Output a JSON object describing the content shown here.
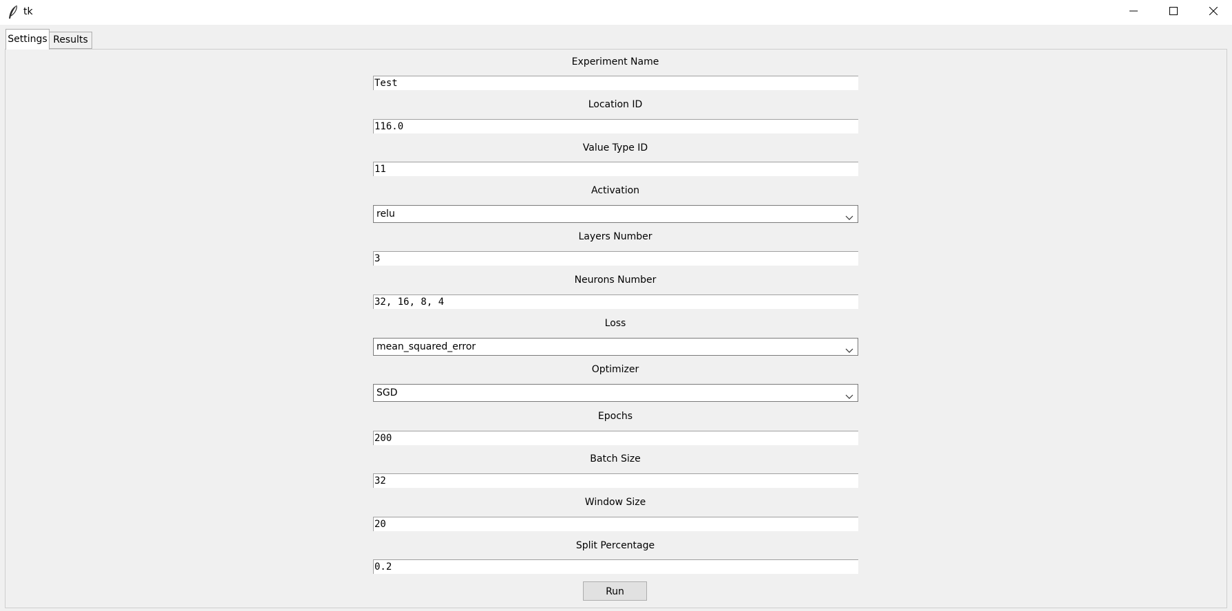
{
  "window": {
    "title": "tk"
  },
  "tabs": [
    {
      "label": "Settings",
      "selected": true
    },
    {
      "label": "Results",
      "selected": false
    }
  ],
  "form": {
    "experiment_name": {
      "label": "Experiment Name",
      "value": "Test"
    },
    "location_id": {
      "label": "Location ID",
      "value": "116.0"
    },
    "value_type_id": {
      "label": "Value Type ID",
      "value": "11"
    },
    "activation": {
      "label": "Activation",
      "value": "relu"
    },
    "layers_number": {
      "label": "Layers Number",
      "value": "3"
    },
    "neurons_number": {
      "label": "Neurons Number",
      "value": "32, 16, 8, 4"
    },
    "loss": {
      "label": "Loss",
      "value": "mean_squared_error"
    },
    "optimizer": {
      "label": "Optimizer",
      "value": "SGD"
    },
    "epochs": {
      "label": "Epochs",
      "value": "200"
    },
    "batch_size": {
      "label": "Batch Size",
      "value": "32"
    },
    "window_size": {
      "label": "Window Size",
      "value": "20"
    },
    "split_percentage": {
      "label": "Split Percentage",
      "value": "0.2"
    }
  },
  "run_button": {
    "label": "Run"
  },
  "icons": {
    "app": "feather-icon",
    "minimize": "minimize-icon",
    "maximize": "maximize-icon",
    "close": "close-icon",
    "dropdown": "chevron-down-icon"
  },
  "colors": {
    "background": "#f0f0f0",
    "entry_background": "#ffffff",
    "button_background": "#e1e1e1"
  }
}
